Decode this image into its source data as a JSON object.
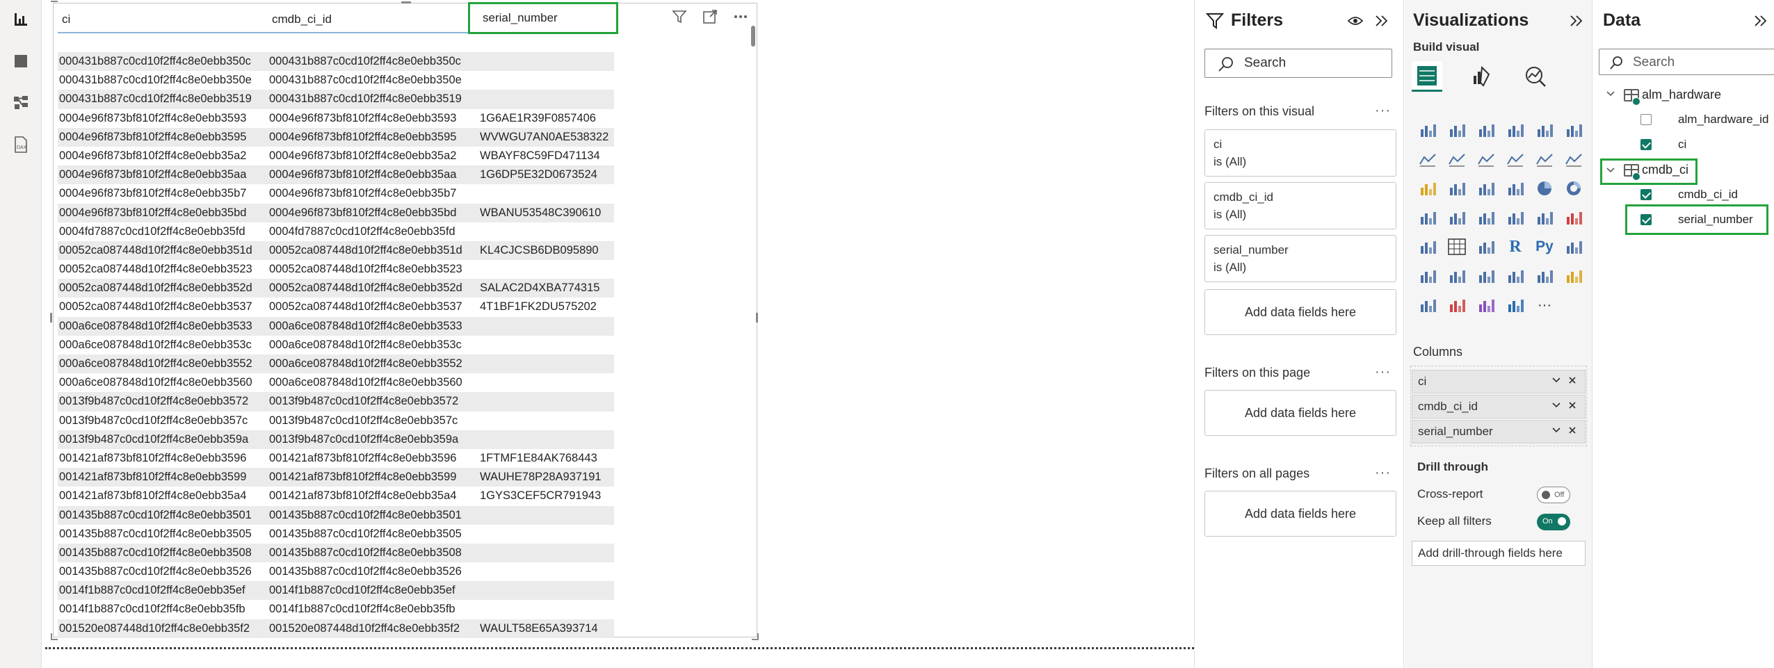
{
  "table_visual": {
    "columns": [
      "ci",
      "cmdb_ci_id",
      "serial_number"
    ],
    "rows": [
      [
        "000431b887c0cd10f2ff4c8e0ebb350c",
        "000431b887c0cd10f2ff4c8e0ebb350c",
        ""
      ],
      [
        "000431b887c0cd10f2ff4c8e0ebb350e",
        "000431b887c0cd10f2ff4c8e0ebb350e",
        ""
      ],
      [
        "000431b887c0cd10f2ff4c8e0ebb3519",
        "000431b887c0cd10f2ff4c8e0ebb3519",
        ""
      ],
      [
        "0004e96f873bf810f2ff4c8e0ebb3593",
        "0004e96f873bf810f2ff4c8e0ebb3593",
        "1G6AE1R39F0857406"
      ],
      [
        "0004e96f873bf810f2ff4c8e0ebb3595",
        "0004e96f873bf810f2ff4c8e0ebb3595",
        "WVWGU7AN0AE538322"
      ],
      [
        "0004e96f873bf810f2ff4c8e0ebb35a2",
        "0004e96f873bf810f2ff4c8e0ebb35a2",
        "WBAYF8C59FD471134"
      ],
      [
        "0004e96f873bf810f2ff4c8e0ebb35aa",
        "0004e96f873bf810f2ff4c8e0ebb35aa",
        "1G6DP5E32D0673524"
      ],
      [
        "0004e96f873bf810f2ff4c8e0ebb35b7",
        "0004e96f873bf810f2ff4c8e0ebb35b7",
        ""
      ],
      [
        "0004e96f873bf810f2ff4c8e0ebb35bd",
        "0004e96f873bf810f2ff4c8e0ebb35bd",
        "WBANU53548C390610"
      ],
      [
        "0004fd7887c0cd10f2ff4c8e0ebb35fd",
        "0004fd7887c0cd10f2ff4c8e0ebb35fd",
        ""
      ],
      [
        "00052ca087448d10f2ff4c8e0ebb351d",
        "00052ca087448d10f2ff4c8e0ebb351d",
        "KL4CJCSB6DB095890"
      ],
      [
        "00052ca087448d10f2ff4c8e0ebb3523",
        "00052ca087448d10f2ff4c8e0ebb3523",
        ""
      ],
      [
        "00052ca087448d10f2ff4c8e0ebb352d",
        "00052ca087448d10f2ff4c8e0ebb352d",
        "SALAC2D4XBA774315"
      ],
      [
        "00052ca087448d10f2ff4c8e0ebb3537",
        "00052ca087448d10f2ff4c8e0ebb3537",
        "4T1BF1FK2DU575202"
      ],
      [
        "000a6ce087848d10f2ff4c8e0ebb3533",
        "000a6ce087848d10f2ff4c8e0ebb3533",
        ""
      ],
      [
        "000a6ce087848d10f2ff4c8e0ebb353c",
        "000a6ce087848d10f2ff4c8e0ebb353c",
        ""
      ],
      [
        "000a6ce087848d10f2ff4c8e0ebb3552",
        "000a6ce087848d10f2ff4c8e0ebb3552",
        ""
      ],
      [
        "000a6ce087848d10f2ff4c8e0ebb3560",
        "000a6ce087848d10f2ff4c8e0ebb3560",
        ""
      ],
      [
        "0013f9b487c0cd10f2ff4c8e0ebb3572",
        "0013f9b487c0cd10f2ff4c8e0ebb3572",
        ""
      ],
      [
        "0013f9b487c0cd10f2ff4c8e0ebb357c",
        "0013f9b487c0cd10f2ff4c8e0ebb357c",
        ""
      ],
      [
        "0013f9b487c0cd10f2ff4c8e0ebb359a",
        "0013f9b487c0cd10f2ff4c8e0ebb359a",
        ""
      ],
      [
        "001421af873bf810f2ff4c8e0ebb3596",
        "001421af873bf810f2ff4c8e0ebb3596",
        "1FTMF1E84AK768443"
      ],
      [
        "001421af873bf810f2ff4c8e0ebb3599",
        "001421af873bf810f2ff4c8e0ebb3599",
        "WAUHE78P28A937191"
      ],
      [
        "001421af873bf810f2ff4c8e0ebb35a4",
        "001421af873bf810f2ff4c8e0ebb35a4",
        "1GYS3CEF5CR791943"
      ],
      [
        "001435b887c0cd10f2ff4c8e0ebb3501",
        "001435b887c0cd10f2ff4c8e0ebb3501",
        ""
      ],
      [
        "001435b887c0cd10f2ff4c8e0ebb3505",
        "001435b887c0cd10f2ff4c8e0ebb3505",
        ""
      ],
      [
        "001435b887c0cd10f2ff4c8e0ebb3508",
        "001435b887c0cd10f2ff4c8e0ebb3508",
        ""
      ],
      [
        "001435b887c0cd10f2ff4c8e0ebb3526",
        "001435b887c0cd10f2ff4c8e0ebb3526",
        ""
      ],
      [
        "0014f1b887c0cd10f2ff4c8e0ebb35ef",
        "0014f1b887c0cd10f2ff4c8e0ebb35ef",
        ""
      ],
      [
        "0014f1b887c0cd10f2ff4c8e0ebb35fb",
        "0014f1b887c0cd10f2ff4c8e0ebb35fb",
        ""
      ],
      [
        "001520e087448d10f2ff4c8e0ebb35f2",
        "001520e087448d10f2ff4c8e0ebb35f2",
        "WAULT58E65A393714"
      ]
    ]
  },
  "filters": {
    "title": "Filters",
    "search_placeholder": "Search",
    "on_visual_label": "Filters on this visual",
    "cards": [
      {
        "field": "ci",
        "state": "is (All)"
      },
      {
        "field": "cmdb_ci_id",
        "state": "is (All)"
      },
      {
        "field": "serial_number",
        "state": "is (All)"
      }
    ],
    "add_fields": "Add data fields here",
    "on_page_label": "Filters on this page",
    "on_all_pages_label": "Filters on all pages",
    "more": "···"
  },
  "visualizations": {
    "title": "Visualizations",
    "build_visual": "Build visual",
    "columns_label": "Columns",
    "column_wells": [
      "ci",
      "cmdb_ci_id",
      "serial_number"
    ],
    "drill_through": "Drill through",
    "cross_report": "Cross-report",
    "cross_report_state": "Off",
    "keep_all_filters": "Keep all filters",
    "keep_all_filters_state": "On",
    "add_drill": "Add drill-through fields here",
    "r_label": "R",
    "py_label": "Py",
    "more": "···"
  },
  "data_pane": {
    "title": "Data",
    "search_placeholder": "Search",
    "tables": [
      {
        "name": "alm_hardware",
        "fields": [
          {
            "name": "alm_hardware_id",
            "checked": false
          },
          {
            "name": "ci",
            "checked": true
          }
        ]
      },
      {
        "name": "cmdb_ci",
        "fields": [
          {
            "name": "cmdb_ci_id",
            "checked": true
          },
          {
            "name": "serial_number",
            "checked": true
          }
        ]
      }
    ]
  },
  "colors": {
    "highlight": "#22a33b",
    "accent": "#117865"
  }
}
